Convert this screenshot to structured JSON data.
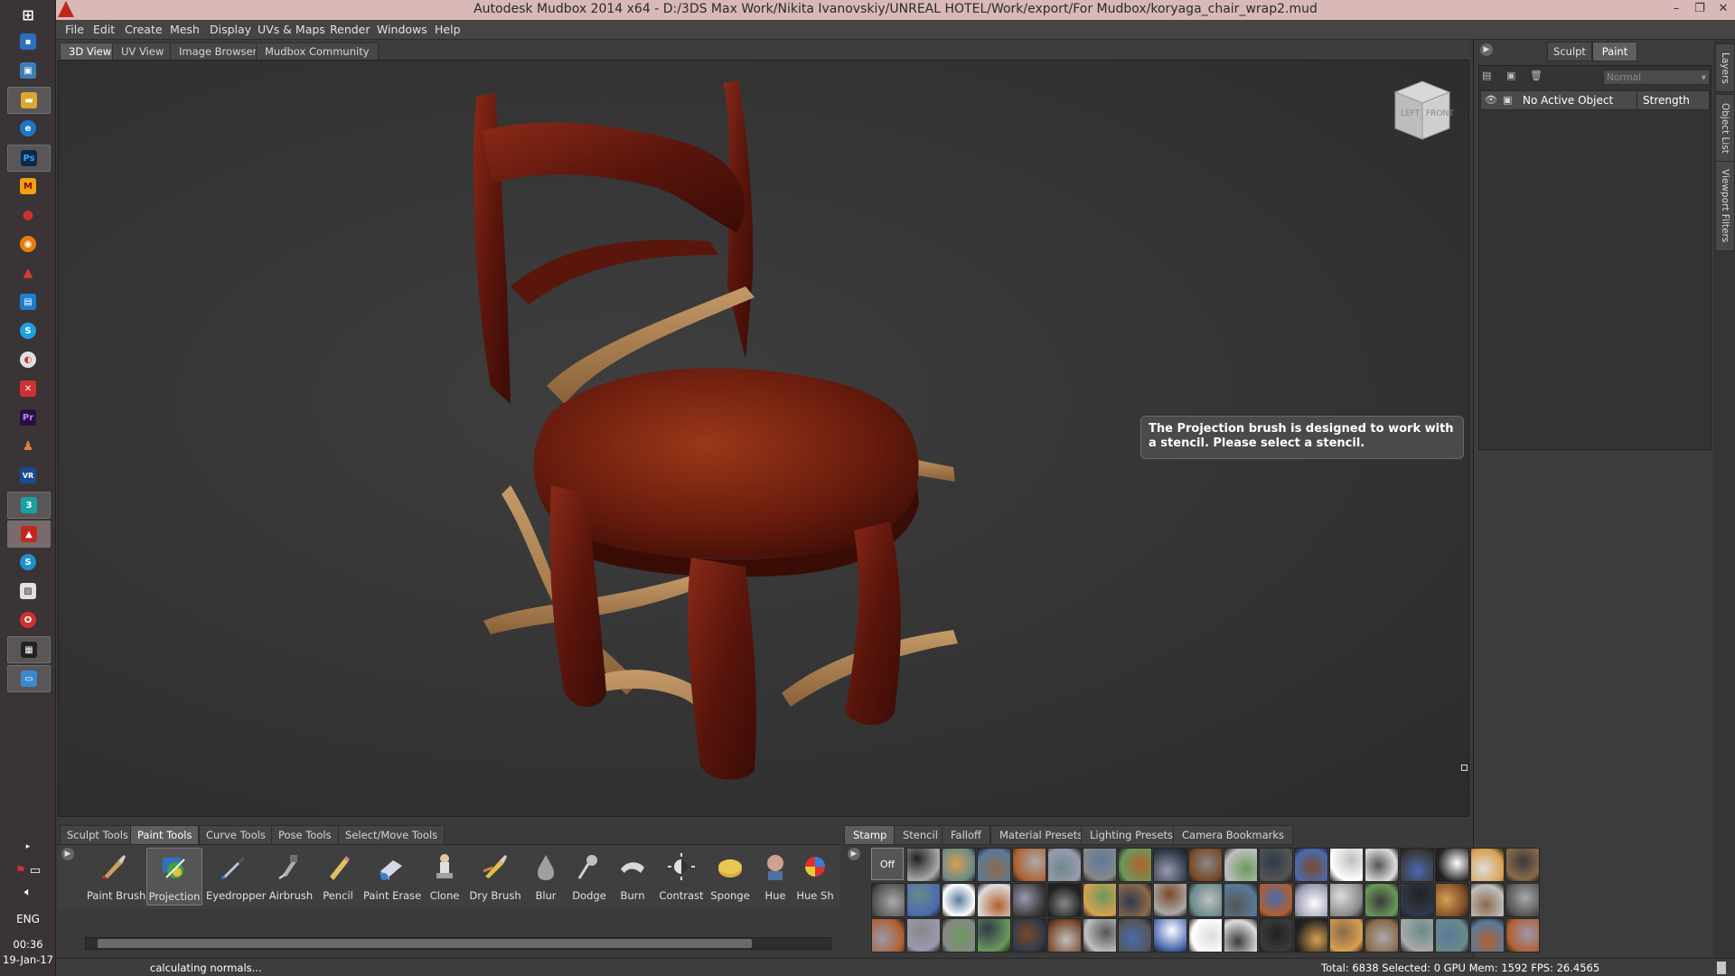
{
  "window": {
    "title": "Autodesk Mudbox 2014 x64 - D:/3DS Max Work/Nikita Ivanovskiy/UNREAL HOTEL/Work/export/For Mudbox/koryaga_chair_wrap2.mud",
    "minimize": "–",
    "restore": "❐",
    "close": "✕"
  },
  "menu": [
    "File",
    "Edit",
    "Create",
    "Mesh",
    "Display",
    "UVs & Maps",
    "Render",
    "Windows",
    "Help"
  ],
  "view_tabs": [
    "3D View",
    "UV View",
    "Image Browser",
    "Mudbox Community"
  ],
  "viewport": {
    "viewcube_left": "LEFT",
    "viewcube_front": "FRONT",
    "tooltip": "The Projection brush is designed to work with a stencil. Please select a stencil."
  },
  "right_panel": {
    "mode_tabs": [
      "Sculpt",
      "Paint"
    ],
    "blend_mode": "Normal",
    "layer_name": "No Active Object",
    "layer_column": "Strength",
    "side_tabs": [
      "Layers",
      "Object List",
      "Viewport Filters"
    ]
  },
  "tool_tabs": [
    "Sculpt Tools",
    "Paint Tools",
    "Curve Tools",
    "Pose Tools",
    "Select/Move Tools"
  ],
  "tools": [
    {
      "label": "Paint Brush",
      "icon": "paint-brush-icon"
    },
    {
      "label": "Projection",
      "icon": "projection-icon"
    },
    {
      "label": "Eyedropper",
      "icon": "eyedropper-icon"
    },
    {
      "label": "Airbrush",
      "icon": "airbrush-icon"
    },
    {
      "label": "Pencil",
      "icon": "pencil-icon"
    },
    {
      "label": "Paint Erase",
      "icon": "paint-erase-icon"
    },
    {
      "label": "Clone",
      "icon": "clone-icon"
    },
    {
      "label": "Dry Brush",
      "icon": "dry-brush-icon"
    },
    {
      "label": "Blur",
      "icon": "blur-icon"
    },
    {
      "label": "Dodge",
      "icon": "dodge-icon"
    },
    {
      "label": "Burn",
      "icon": "burn-icon"
    },
    {
      "label": "Contrast",
      "icon": "contrast-icon"
    },
    {
      "label": "Sponge",
      "icon": "sponge-icon"
    },
    {
      "label": "Hue",
      "icon": "hue-icon"
    },
    {
      "label": "Hue Sh",
      "icon": "hue-shift-icon"
    }
  ],
  "stamp_tabs": [
    "Stamp",
    "Stencil",
    "Falloff",
    "Material Presets",
    "Lighting Presets",
    "Camera Bookmarks"
  ],
  "stamp_off_label": "Off",
  "status": {
    "message": "calculating normals...",
    "stats": "Total: 6838  Selected: 0 GPU Mem: 1592  FPS: 26.4565"
  },
  "taskbar": {
    "language": "ENG",
    "time": "00:36",
    "date": "19-Jan-17"
  },
  "colors": {
    "wood_dark": "#6b1d12",
    "wood_light": "#b08050",
    "title_bar": "#d9b8b8",
    "panel_bg": "#3a3a3a"
  }
}
